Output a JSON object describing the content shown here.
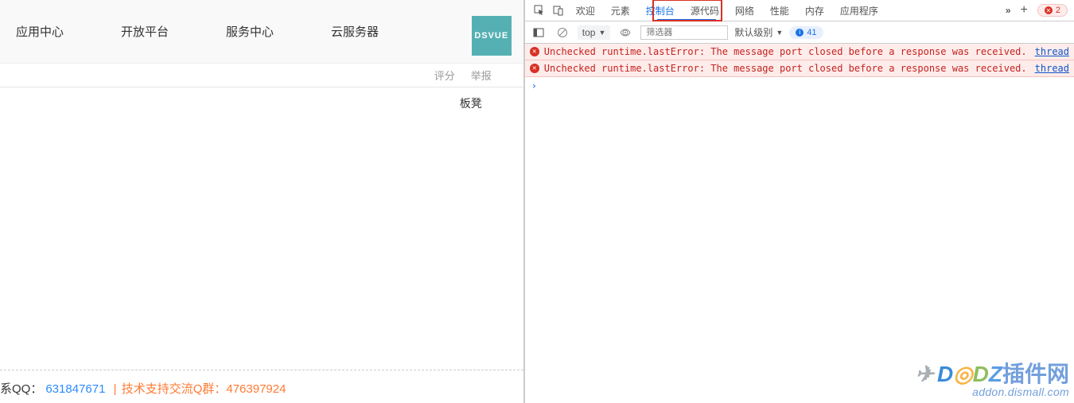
{
  "nav": {
    "items": [
      "应用中心",
      "开放平台",
      "服务中心",
      "云服务器"
    ],
    "brand": "DSVUE"
  },
  "sub": {
    "score": "评分",
    "report": "举报"
  },
  "bench": "板凳",
  "footer": {
    "qq_label": "系QQ：",
    "qq_num": "631847671",
    "support": "技术支持交流Q群：",
    "support_num": "476397924"
  },
  "devtools": {
    "tabs": [
      "欢迎",
      "元素",
      "控制台",
      "源代码",
      "网络",
      "性能",
      "内存",
      "应用程序"
    ],
    "active_tab_index": 2,
    "error_count": "2",
    "filter_bar": {
      "context": "top",
      "filter_placeholder": "筛选器",
      "level": "默认级别",
      "hidden_count": "41"
    },
    "console": {
      "errors": [
        {
          "msg": "Unchecked runtime.lastError: The message port closed before a response was received.",
          "link": "thread"
        },
        {
          "msg": "Unchecked runtime.lastError: The message port closed before a response was received.",
          "link": "thread"
        }
      ]
    }
  },
  "watermark": {
    "main_cn": "插件网",
    "sub": "addon.dismall.com"
  }
}
